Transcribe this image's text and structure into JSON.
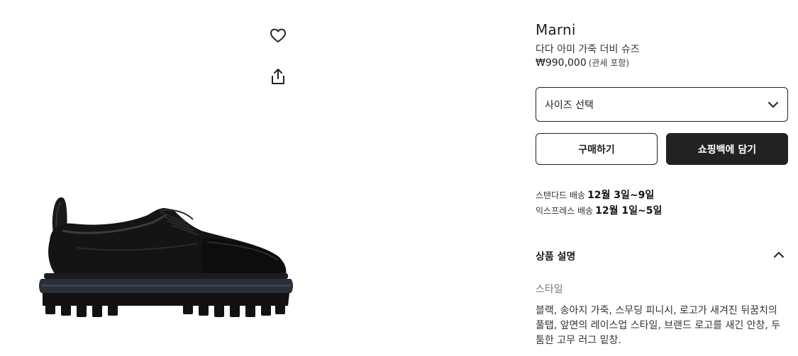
{
  "gallery": {
    "wishlist_icon": "heart-icon",
    "share_icon": "share-icon",
    "image_subject": "black leather derby shoe with rubber toe cap and lug sole"
  },
  "product": {
    "brand": "Marni",
    "name": "다다 아미 가죽 더비 슈즈",
    "price": "₩990,000",
    "price_note": "(관세 포함)"
  },
  "size_select": {
    "label": "사이즈 선택",
    "icon": "chevron-down-icon"
  },
  "actions": {
    "buy_label": "구매하기",
    "bag_label": "쇼핑백에 담기"
  },
  "shipping": {
    "standard_label": "스탠다드 배송",
    "standard_dates": "12월 3일~9일",
    "express_label": "익스프레스 배송",
    "express_dates": "12월 1일~5일"
  },
  "description": {
    "title": "상품 설명",
    "toggle_icon": "chevron-up-icon",
    "style_label": "스타일",
    "text": "블랙, 송아지 가죽, 스무딩 피니시, 로고가 새겨진 뒤꿈치의 풀탭, 앞면의 레이스업 스타일, 브랜드 로고를 새긴 안창, 두툼한 고무 러그 밑창."
  },
  "colors": {
    "primary": "#222222",
    "muted": "#777777",
    "background": "#ffffff"
  }
}
